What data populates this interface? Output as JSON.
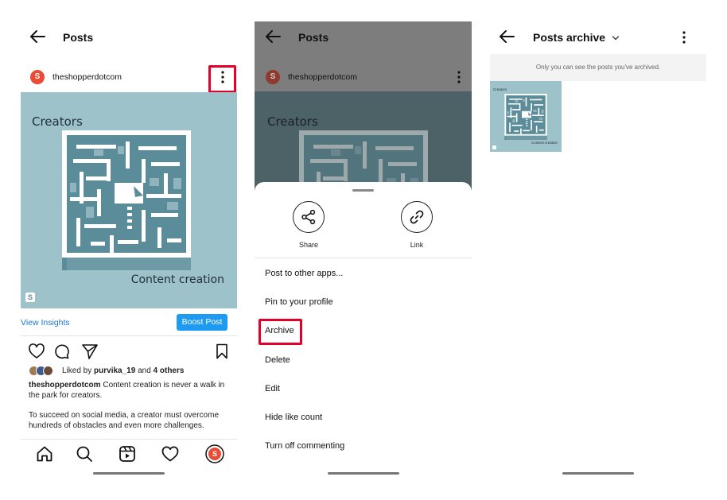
{
  "panel1": {
    "title": "Posts",
    "username": "theshopperdotcom",
    "avatar_letter": "S",
    "post_text_top": "Creators",
    "post_text_bottom": "Content creation",
    "post_logo": "S",
    "view_insights": "View Insights",
    "boost_post": "Boost Post",
    "likes": {
      "prefix": "Liked by ",
      "user": "purvika_19",
      "middle": " and ",
      "others": "4 others"
    },
    "caption": {
      "user": "theshopperdotcom",
      "text": " Content creation is never a walk in the park for creators."
    },
    "caption2": "To succeed on social media, a creator must overcome hundreds of obstacles and even more challenges.",
    "nav_avatar_letter": "S"
  },
  "panel2": {
    "title": "Posts",
    "username": "theshopperdotcom",
    "avatar_letter": "S",
    "post_text_top": "Creators",
    "share_label": "Share",
    "link_label": "Link",
    "menu_items": [
      "Post to other apps...",
      "Pin to your profile",
      "Archive",
      "Delete",
      "Edit",
      "Hide like count",
      "Turn off commenting"
    ]
  },
  "panel3": {
    "title": "Posts archive",
    "notice": "Only you can see the posts you've archived.",
    "thumb_top": "Creators",
    "thumb_bottom": "Content creation"
  },
  "colors": {
    "highlight": "#e5002a",
    "accent_blue": "#1e9bf0",
    "post_bg": "#9ec2ca",
    "maze_dark": "#5b8c99",
    "avatar": "#e94b35"
  },
  "icons": [
    "back-arrow-icon",
    "kebab-icon",
    "heart-icon",
    "comment-icon",
    "send-icon",
    "bookmark-icon",
    "home-icon",
    "search-icon",
    "reels-icon",
    "share-icon",
    "link-icon",
    "chevron-down-icon"
  ]
}
